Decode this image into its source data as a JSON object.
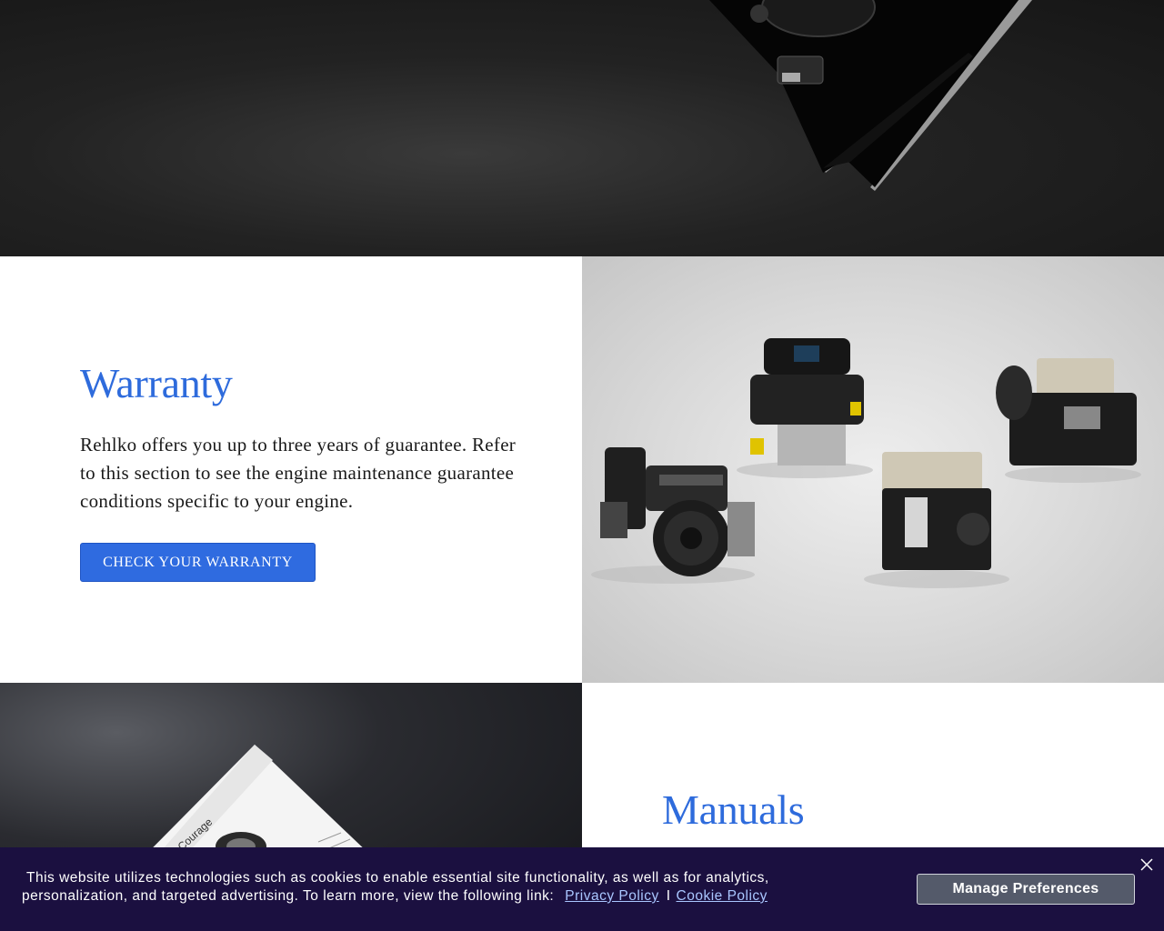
{
  "hero": {
    "image": "engine-product-on-dark-background"
  },
  "warranty": {
    "title": "Warranty",
    "body": "Rehlko offers you up to three years of guarantee. Refer to this section to see the engine maintenance guarantee conditions specific to your engine.",
    "button_label": "CHECK YOUR WARRANTY",
    "image": "engine-lineup-photo"
  },
  "manuals": {
    "title": "Manuals",
    "image": "manual-booklet-photo"
  },
  "cookie": {
    "line1": "This website utilizes technologies such as cookies to enable essential site functionality, as well as for analytics,",
    "line2": "personalization, and targeted advertising. To learn more, view the following link:",
    "privacy_link": "Privacy Policy",
    "separator": "I",
    "cookie_link": "Cookie Policy",
    "manage_label": "Manage Preferences",
    "close_icon": "close-icon"
  },
  "colors": {
    "accent": "#2f6be0",
    "title": "#2e6bdc",
    "banner_bg": "#1b1040",
    "manage_bg": "#545a6a"
  }
}
